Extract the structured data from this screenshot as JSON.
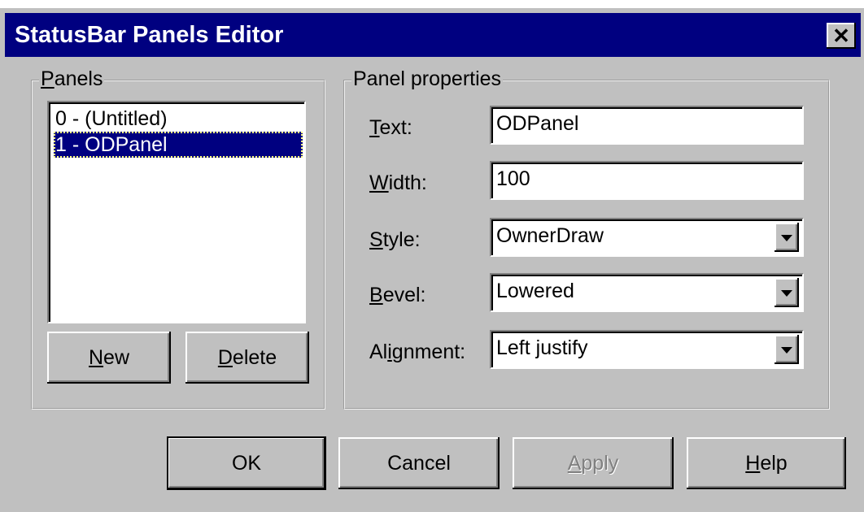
{
  "window": {
    "title": "StatusBar Panels Editor",
    "close_glyph": "✕"
  },
  "panels_group": {
    "title_accel": "P",
    "title_rest": "anels",
    "items": [
      "0 - (Untitled)",
      "1 - ODPanel"
    ],
    "selected_index": 1,
    "new_accel": "N",
    "new_rest": "ew",
    "delete_accel": "D",
    "delete_rest": "elete"
  },
  "properties_group": {
    "title": "Panel properties",
    "text_label_accel": "T",
    "text_label_rest": "ext:",
    "text_value": "ODPanel",
    "width_label_accel": "W",
    "width_label_rest": "idth:",
    "width_value": "100",
    "style_label_accel": "S",
    "style_label_rest": "tyle:",
    "style_value": "OwnerDraw",
    "bevel_label_accel": "B",
    "bevel_label_rest": "evel:",
    "bevel_value": "Lowered",
    "alignment_label_pre": "Al",
    "alignment_label_accel": "i",
    "alignment_label_rest": "gnment:",
    "alignment_value": "Left justify"
  },
  "buttons": {
    "ok": "OK",
    "cancel": "Cancel",
    "apply_accel": "A",
    "apply_rest": "pply",
    "help_accel": "H",
    "help_rest": "elp"
  }
}
